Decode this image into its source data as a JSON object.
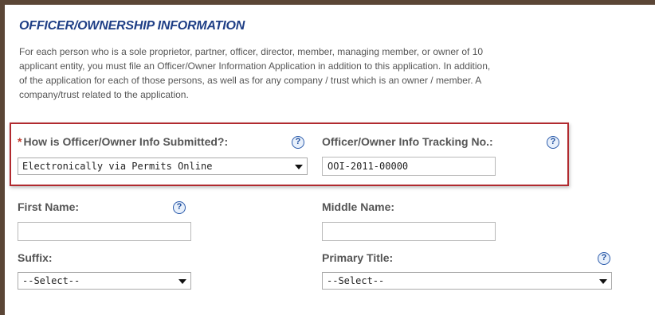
{
  "section": {
    "title": "OFFICER/OWNERSHIP INFORMATION",
    "intro_lines": [
      "For each person who is a sole proprietor, partner, officer, director, member, managing member, or owner of 10",
      "applicant entity, you must file an Officer/Owner Information Application in addition to this application. In addition,",
      "of the application for each of those persons, as well as for any company / trust which is an owner / member. A",
      "company/trust related to the application."
    ]
  },
  "fields": {
    "submission_method": {
      "required_marker": "*",
      "label": "How is Officer/Owner Info Submitted?:",
      "value": "Electronically via Permits Online"
    },
    "tracking_number": {
      "label": "Officer/Owner Info Tracking No.:",
      "value": "OOI-2011-00000"
    },
    "first_name": {
      "label": "First Name:",
      "value": ""
    },
    "middle_name": {
      "label": "Middle Name:",
      "value": ""
    },
    "suffix": {
      "label": "Suffix:",
      "value": "--Select--"
    },
    "primary_title": {
      "label": "Primary Title:",
      "value": "--Select--"
    }
  },
  "help_icon_glyph": "?",
  "colors": {
    "title": "#1f3f86",
    "highlight_border": "#b12a2f",
    "help_icon": "#2b5bab",
    "frame": "#5b4636"
  }
}
